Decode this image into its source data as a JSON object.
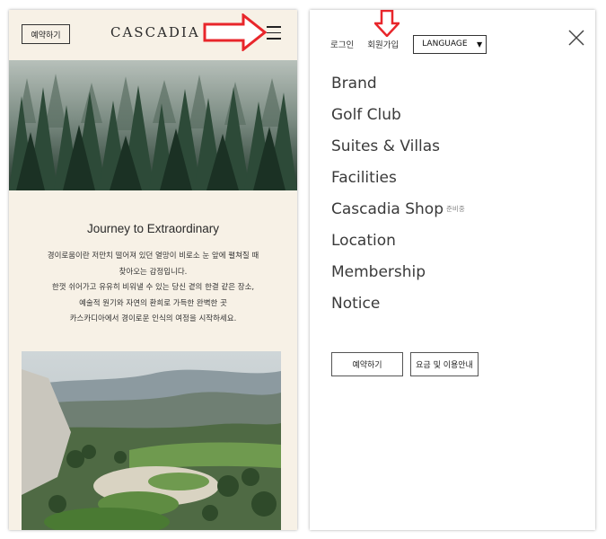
{
  "left": {
    "reserve_label": "예약하기",
    "logo": "CASCADIA",
    "hamburger_icon": "hamburger-menu-icon",
    "annotation_arrow_color": "#e8262b",
    "journey_title": "Journey to Extraordinary",
    "journey_lines": [
      "경이로움이란 저만치 떨어져 있던 열망이 비로소 눈 앞에 펼쳐질 때",
      "찾아오는 감정입니다.",
      "한껏 쉬어가고 유유히 비워낼 수 있는 당신 곁의 한결 같은 장소,",
      "예술적 원기와 자연의 환희로 가득한 완벽한 곳",
      "카스카디아에서 경이로운 인식의 여정을 시작하세요."
    ]
  },
  "right": {
    "login_label": "로그인",
    "signup_label": "회원가입",
    "language_label": "LANGUAGE",
    "close_icon": "close-icon",
    "menu_items": [
      {
        "label": "Brand",
        "tag": ""
      },
      {
        "label": "Golf Club",
        "tag": ""
      },
      {
        "label": "Suites & Villas",
        "tag": ""
      },
      {
        "label": "Facilities",
        "tag": ""
      },
      {
        "label": "Cascadia Shop",
        "tag": "준비중"
      },
      {
        "label": "Location",
        "tag": ""
      },
      {
        "label": "Membership",
        "tag": ""
      },
      {
        "label": "Notice",
        "tag": ""
      }
    ],
    "reserve_label": "예약하기",
    "rates_label": "요금 및 이용안내"
  },
  "colors": {
    "cream_bg": "#f7f1e6",
    "annotation_red": "#e8262b",
    "text_dark": "#3a3a3a"
  }
}
